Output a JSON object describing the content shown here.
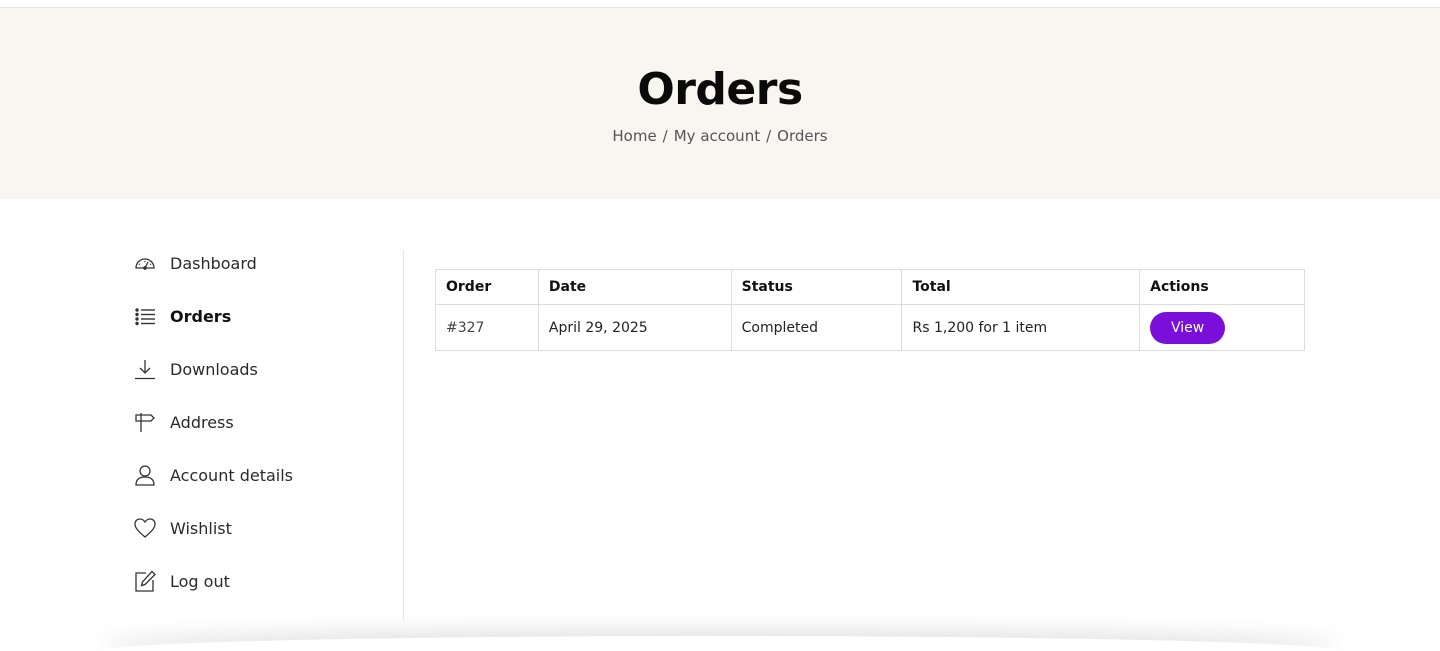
{
  "hero": {
    "title": "Orders",
    "breadcrumb": [
      {
        "label": "Home"
      },
      {
        "label": "My account"
      },
      {
        "label": "Orders"
      }
    ],
    "separator": "/"
  },
  "sidebar": {
    "items": [
      {
        "label": "Dashboard",
        "icon": "dashboard-gauge-icon"
      },
      {
        "label": "Orders",
        "icon": "list-icon",
        "active": true
      },
      {
        "label": "Downloads",
        "icon": "download-icon"
      },
      {
        "label": "Address",
        "icon": "signpost-icon"
      },
      {
        "label": "Account details",
        "icon": "user-icon"
      },
      {
        "label": "Wishlist",
        "icon": "heart-icon"
      },
      {
        "label": "Log out",
        "icon": "edit-square-icon"
      }
    ]
  },
  "orders": {
    "headers": [
      "Order",
      "Date",
      "Status",
      "Total",
      "Actions"
    ],
    "rows": [
      {
        "order": "#327",
        "date": "April 29, 2025",
        "status": "Completed",
        "total": "Rs 1,200 for 1 item",
        "action": "View"
      }
    ]
  },
  "colors": {
    "hero_bg": "#f7f6f0",
    "accent": "#7a0fd9"
  }
}
